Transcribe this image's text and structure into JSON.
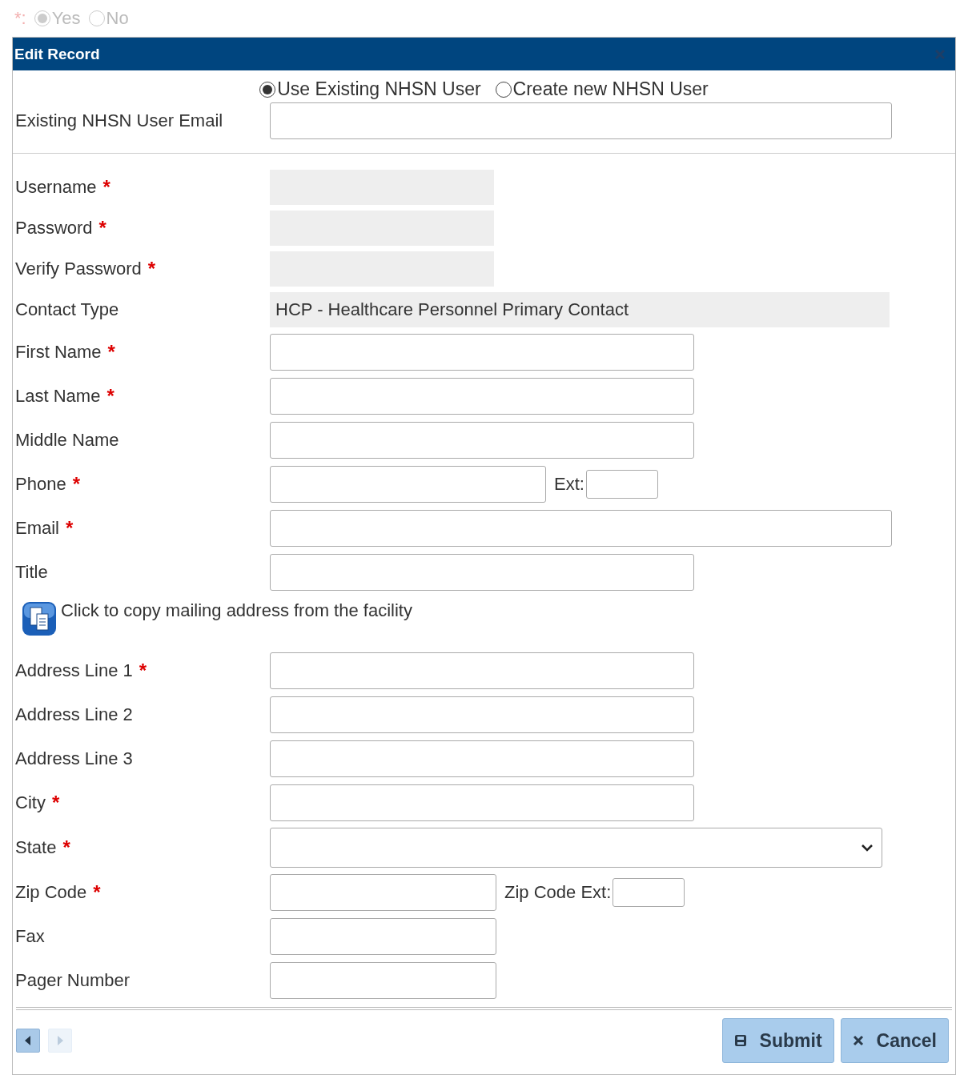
{
  "background_question": {
    "mark": "*:",
    "options": [
      {
        "label": "Yes",
        "selected": true
      },
      {
        "label": "No",
        "selected": false
      }
    ]
  },
  "dialog": {
    "title": "Edit Record",
    "required_mark": "*",
    "user_mode": [
      {
        "label": "Use Existing NHSN User",
        "selected": true
      },
      {
        "label": "Create new NHSN User",
        "selected": false
      }
    ],
    "existing_email": {
      "label": "Existing NHSN User Email"
    },
    "fields": [
      {
        "kind": "readonly",
        "label": "Username",
        "required": true
      },
      {
        "kind": "readonly",
        "label": "Password",
        "required": true
      },
      {
        "kind": "readonly",
        "label": "Verify Password",
        "required": true
      },
      {
        "kind": "display",
        "label": "Contact Type",
        "required": false,
        "value": "HCP - Healthcare Personnel Primary Contact"
      },
      {
        "kind": "medium",
        "label": "First Name",
        "required": true
      },
      {
        "kind": "medium",
        "label": "Last Name",
        "required": true
      },
      {
        "kind": "medium",
        "label": "Middle Name",
        "required": false
      },
      {
        "kind": "phone",
        "label": "Phone",
        "required": true,
        "extension": "Ext:"
      },
      {
        "kind": "wide",
        "label": "Email",
        "required": true
      },
      {
        "kind": "medium",
        "label": "Title",
        "required": false
      },
      {
        "kind": "copy",
        "label": "Click to copy mailing address from the facility"
      },
      {
        "kind": "medium",
        "label": "Address Line 1",
        "required": true
      },
      {
        "kind": "medium",
        "label": "Address Line 2",
        "required": false
      },
      {
        "kind": "medium",
        "label": "Address Line 3",
        "required": false
      },
      {
        "kind": "medium",
        "label": "City",
        "required": true
      },
      {
        "kind": "select",
        "label": "State",
        "required": true
      },
      {
        "kind": "short",
        "label": "Zip Code",
        "required": true,
        "extension": "Zip Code Ext:"
      },
      {
        "kind": "short",
        "label": "Fax",
        "required": false
      },
      {
        "kind": "short",
        "label": "Pager Number",
        "required": false
      }
    ],
    "pager": [
      {
        "kind": "prev",
        "disabled": false
      },
      {
        "kind": "next",
        "disabled": true
      }
    ],
    "buttons": [
      {
        "kind": "submit",
        "label": "Submit"
      },
      {
        "kind": "cancel",
        "label": "Cancel"
      }
    ]
  }
}
